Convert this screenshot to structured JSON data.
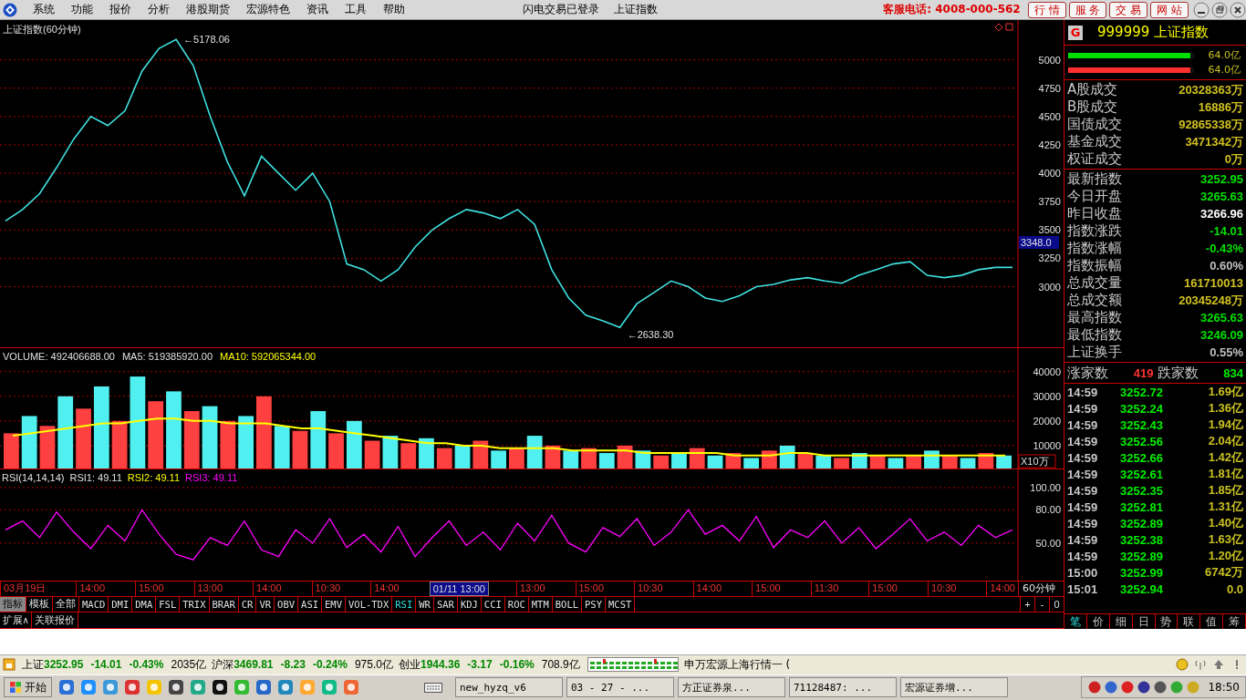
{
  "menu_bar": {
    "items": [
      "系统",
      "功能",
      "报价",
      "分析",
      "港股期货",
      "宏源特色",
      "资讯",
      "工具",
      "帮助"
    ],
    "login_status": "闪电交易已登录",
    "current_view": "上证指数",
    "hotline": "客服电话: 4008-000-562",
    "service_buttons": [
      "行 情",
      "服 务",
      "交 易",
      "网 站"
    ]
  },
  "price_panel": {
    "title": "上证指数(60分钟)",
    "chart_data": {
      "type": "line",
      "grid": true,
      "ylim": [
        2450,
        5350
      ],
      "yticks": [
        3000,
        3250,
        3500,
        3750,
        4000,
        4250,
        4500,
        4750,
        5000
      ],
      "series": [
        {
          "color": "#40e0e0",
          "values": [
            3580,
            3680,
            3820,
            4050,
            4300,
            4500,
            4420,
            4550,
            4900,
            5100,
            5180,
            4950,
            4500,
            4100,
            3800,
            4150,
            4000,
            3850,
            4000,
            3750,
            3200,
            3150,
            3050,
            3150,
            3350,
            3500,
            3600,
            3680,
            3650,
            3600,
            3680,
            3550,
            3150,
            2900,
            2750,
            2700,
            2640,
            2850,
            2950,
            3050,
            3000,
            2900,
            2870,
            2920,
            3000,
            3020,
            3060,
            3080,
            3050,
            3030,
            3100,
            3150,
            3200,
            3220,
            3100,
            3080,
            3100,
            3150,
            3170,
            3170
          ]
        }
      ],
      "annotations": [
        "←5178.06",
        "←2638.30"
      ]
    },
    "cursor_price": "3348.0"
  },
  "volume_panel": {
    "legend": [
      {
        "text": "VOLUME: 492406688.00",
        "color": "#e0e0e0"
      },
      {
        "text": "MA5: 519385920.00",
        "color": "#e0e0e0"
      },
      {
        "text": "MA10: 592065344.00",
        "color": "#ffff00"
      }
    ],
    "unit": "X10万",
    "chart_data": {
      "type": "bar",
      "grid": true,
      "stacked": false,
      "ylim": [
        0,
        49500
      ],
      "yticks": [
        10000,
        20000,
        30000,
        40000
      ],
      "series": [
        {
          "color": "#ff4040",
          "values": [
            15000,
            null,
            18000,
            null,
            25000,
            null,
            20000,
            null,
            28000,
            null,
            24000,
            null,
            20000,
            null,
            30000,
            null,
            16000,
            null,
            15000,
            null,
            12000,
            null,
            11000,
            null,
            9000,
            null,
            12000,
            null,
            9000,
            null,
            10000,
            null,
            9000,
            null,
            10000,
            null,
            6000,
            null,
            9000,
            null,
            7000,
            null,
            8000,
            null,
            7000,
            null,
            5000,
            null,
            6000,
            null,
            6000,
            null,
            6000,
            null,
            7000,
            null
          ]
        },
        {
          "color": "#50f0f0",
          "values": [
            null,
            22000,
            null,
            30000,
            null,
            34000,
            null,
            38000,
            null,
            32000,
            null,
            26000,
            null,
            22000,
            null,
            18000,
            null,
            24000,
            null,
            20000,
            null,
            14000,
            null,
            13000,
            null,
            10000,
            null,
            8000,
            null,
            14000,
            null,
            8000,
            null,
            7000,
            null,
            8000,
            null,
            7000,
            null,
            6000,
            null,
            5000,
            null,
            10000,
            null,
            6000,
            null,
            7000,
            null,
            5000,
            null,
            8000,
            null,
            5000,
            null,
            6000
          ]
        },
        {
          "type": "line",
          "color": "#ffff00",
          "values": [
            14000,
            15000,
            16000,
            17000,
            18000,
            19000,
            19000,
            20000,
            21000,
            21000,
            20000,
            20000,
            19000,
            19000,
            19000,
            18000,
            17000,
            17000,
            16000,
            15000,
            14000,
            13000,
            12000,
            11000,
            11000,
            10000,
            10000,
            9000,
            9000,
            9000,
            9000,
            8000,
            8000,
            8000,
            8000,
            7000,
            7000,
            7000,
            7000,
            7000,
            6000,
            6000,
            6000,
            7000,
            7000,
            6000,
            6000,
            6000,
            6000,
            6000,
            6000,
            6000,
            6000,
            6000,
            6000,
            6000
          ]
        }
      ]
    }
  },
  "rsi_panel": {
    "legend": [
      {
        "text": "RSI(14,14,14)",
        "color": "#e0e0e0"
      },
      {
        "text": "RSI1: 49.11",
        "color": "#e0e0e0"
      },
      {
        "text": "RSI2: 49.11",
        "color": "#ffff00"
      },
      {
        "text": "RSI3: 49.11",
        "color": "#ff00ff"
      }
    ],
    "chart_data": {
      "type": "line",
      "grid": true,
      "ylim": [
        15.5,
        116.4
      ],
      "yticks": [
        {
          "value": 50,
          "label": "50.00"
        },
        {
          "value": 80,
          "label": "80.00"
        },
        {
          "value": 100,
          "label": "100.00"
        }
      ],
      "series": [
        {
          "color": "#ff00ff",
          "values": [
            62,
            70,
            55,
            78,
            60,
            45,
            66,
            52,
            80,
            58,
            40,
            35,
            55,
            48,
            70,
            44,
            38,
            62,
            50,
            72,
            46,
            58,
            42,
            65,
            38,
            55,
            70,
            48,
            60,
            44,
            68,
            52,
            75,
            50,
            42,
            64,
            56,
            72,
            48,
            60,
            80,
            58,
            66,
            52,
            74,
            46,
            62,
            55,
            70,
            50,
            64,
            45,
            58,
            72,
            52,
            60,
            48,
            66,
            55,
            62
          ]
        }
      ]
    }
  },
  "time_axis": {
    "labels": [
      {
        "text": "03月19日",
        "selected": false
      },
      {
        "text": "14:00",
        "selected": false
      },
      {
        "text": "15:00",
        "selected": false
      },
      {
        "text": "13:00",
        "selected": false
      },
      {
        "text": "14:00",
        "selected": false
      },
      {
        "text": "10:30",
        "selected": false
      },
      {
        "text": "14:00",
        "selected": false
      },
      {
        "text": "01/11 13:00",
        "selected": true
      },
      {
        "text": "13:00",
        "selected": false
      },
      {
        "text": "15:00",
        "selected": false
      },
      {
        "text": "10:30",
        "selected": false
      },
      {
        "text": "14:00",
        "selected": false
      },
      {
        "text": "15:00",
        "selected": false
      },
      {
        "text": "11:30",
        "selected": false
      },
      {
        "text": "15:00",
        "selected": false
      },
      {
        "text": "10:30",
        "selected": false
      },
      {
        "text": "14:00",
        "selected": false
      }
    ],
    "period": "60分钟"
  },
  "indicator_tabs": [
    {
      "label": "指标",
      "selected": true,
      "active": false
    },
    {
      "label": "模板",
      "selected": false,
      "active": false
    },
    {
      "label": "全部",
      "selected": false,
      "active": false
    },
    {
      "label": "MACD",
      "selected": false,
      "active": false
    },
    {
      "label": "DMI",
      "selected": false,
      "active": false
    },
    {
      "label": "DMA",
      "selected": false,
      "active": false
    },
    {
      "label": "FSL",
      "selected": false,
      "active": false
    },
    {
      "label": "TRIX",
      "selected": false,
      "active": false
    },
    {
      "label": "BRAR",
      "selected": false,
      "active": false
    },
    {
      "label": "CR",
      "selected": false,
      "active": false
    },
    {
      "label": "VR",
      "selected": false,
      "active": false
    },
    {
      "label": "OBV",
      "selected": false,
      "active": false
    },
    {
      "label": "ASI",
      "selected": false,
      "active": false
    },
    {
      "label": "EMV",
      "selected": false,
      "active": false
    },
    {
      "label": "VOL-TDX",
      "selected": false,
      "active": false
    },
    {
      "label": "RSI",
      "selected": false,
      "active": true
    },
    {
      "label": "WR",
      "selected": false,
      "active": false
    },
    {
      "label": "SAR",
      "selected": false,
      "active": false
    },
    {
      "label": "KDJ",
      "selected": false,
      "active": false
    },
    {
      "label": "CCI",
      "selected": false,
      "active": false
    },
    {
      "label": "ROC",
      "selected": false,
      "active": false
    },
    {
      "label": "MTM",
      "selected": false,
      "active": false
    },
    {
      "label": "BOLL",
      "selected": false,
      "active": false
    },
    {
      "label": "PSY",
      "selected": false,
      "active": false
    },
    {
      "label": "MCST",
      "selected": false,
      "active": false
    }
  ],
  "zoom_buttons": [
    "+",
    "-",
    "0"
  ],
  "extra_tabs": [
    "扩展∧",
    "关联报价"
  ],
  "quote_panel": {
    "badge": "G",
    "title": "999999 上证指数",
    "strength_bars": [
      {
        "level": 0.97,
        "reading": "64.0亿",
        "color": "#00e000"
      },
      {
        "level": 0.97,
        "reading": "64.0亿",
        "color": "#ff3030"
      }
    ],
    "turnover_rows": [
      {
        "label": "A股成交",
        "value": "20328363万",
        "color": "#d0c020"
      },
      {
        "label": "B股成交",
        "value": "16886万",
        "color": "#d0c020"
      },
      {
        "label": "国债成交",
        "value": "92865338万",
        "color": "#d0c020"
      },
      {
        "label": "基金成交",
        "value": "3471342万",
        "color": "#d0c020"
      },
      {
        "label": "权证成交",
        "value": "0万",
        "color": "#d0c020"
      }
    ],
    "index_rows": [
      {
        "label": "最新指数",
        "value": "3252.95",
        "color": "#00e000"
      },
      {
        "label": "今日开盘",
        "value": "3265.63",
        "color": "#00e000"
      },
      {
        "label": "昨日收盘",
        "value": "3266.96",
        "color": "#ffffff"
      },
      {
        "label": "指数涨跌",
        "value": "-14.01",
        "color": "#00e000"
      },
      {
        "label": "指数涨幅",
        "value": "-0.43%",
        "color": "#00e000"
      },
      {
        "label": "指数振幅",
        "value": "0.60%",
        "color": "#c0c0c0"
      },
      {
        "label": "总成交量",
        "value": "161710013",
        "color": "#d0c020"
      },
      {
        "label": "总成交额",
        "value": "20345248万",
        "color": "#d0c020"
      },
      {
        "label": "最高指数",
        "value": "3265.63",
        "color": "#00e000"
      },
      {
        "label": "最低指数",
        "value": "3246.09",
        "color": "#00e000"
      },
      {
        "label": "上证换手",
        "value": "0.55%",
        "color": "#c0c0c0"
      }
    ],
    "breadth": {
      "up_label": "涨家数",
      "up_count": "419",
      "down_label": "跌家数",
      "down_count": "834"
    },
    "ticks": [
      {
        "time": "14:59",
        "price": "3252.72",
        "volume": "1.69亿"
      },
      {
        "time": "14:59",
        "price": "3252.24",
        "volume": "1.36亿"
      },
      {
        "time": "14:59",
        "price": "3252.43",
        "volume": "1.94亿"
      },
      {
        "time": "14:59",
        "price": "3252.56",
        "volume": "2.04亿"
      },
      {
        "time": "14:59",
        "price": "3252.66",
        "volume": "1.42亿"
      },
      {
        "time": "14:59",
        "price": "3252.61",
        "volume": "1.81亿"
      },
      {
        "time": "14:59",
        "price": "3252.35",
        "volume": "1.85亿"
      },
      {
        "time": "14:59",
        "price": "3252.81",
        "volume": "1.31亿"
      },
      {
        "time": "14:59",
        "price": "3252.89",
        "volume": "1.40亿"
      },
      {
        "time": "14:59",
        "price": "3252.38",
        "volume": "1.63亿"
      },
      {
        "time": "14:59",
        "price": "3252.89",
        "volume": "1.20亿"
      },
      {
        "time": "15:00",
        "price": "3252.99",
        "volume": "6742万"
      },
      {
        "time": "15:01",
        "price": "3252.94",
        "volume": "0.0"
      }
    ],
    "tabs": [
      {
        "label": "笔",
        "selected": true
      },
      {
        "label": "价",
        "selected": false
      },
      {
        "label": "细",
        "selected": false
      },
      {
        "label": "日",
        "selected": false
      },
      {
        "label": "势",
        "selected": false
      },
      {
        "label": "联",
        "selected": false
      },
      {
        "label": "值",
        "selected": false
      },
      {
        "label": "筹",
        "selected": false
      }
    ]
  },
  "status_bar": {
    "indices": [
      {
        "name": "上证",
        "value": "3252.95",
        "change": "-14.01",
        "percent": "-0.43%",
        "amount": "2035亿"
      },
      {
        "name": "沪深",
        "value": "3469.81",
        "change": "-8.23",
        "percent": "-0.24%",
        "amount": "975.0亿"
      },
      {
        "name": "创业",
        "value": "1944.36",
        "change": "-3.17",
        "percent": "-0.16%",
        "amount": "708.9亿"
      }
    ],
    "server": "申万宏源上海行情一 ("
  },
  "taskbar": {
    "start": "开始",
    "windows": [
      "new_hyzq_v6",
      "03 - 27 - ...",
      "方正证券泉...",
      "71128487: ...",
      "宏源证券增..."
    ],
    "clock": "18:50"
  }
}
